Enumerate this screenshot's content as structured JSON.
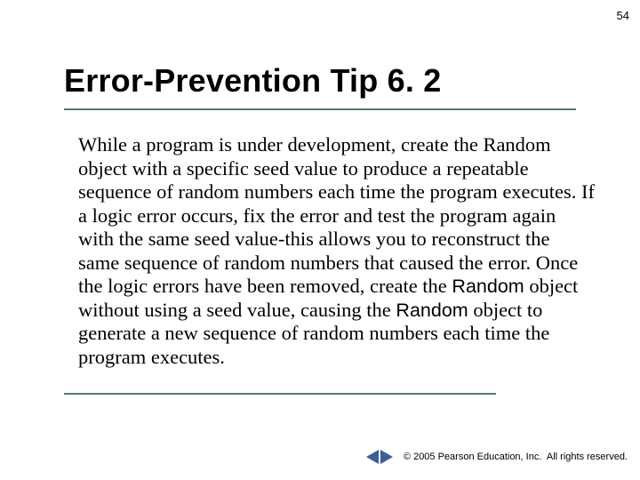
{
  "page_number": "54",
  "title": "Error-Prevention Tip 6. 2",
  "body": {
    "part1": "While a program is under development, create the Random object with a specific seed value to produce a repeatable sequence of random numbers each time the program executes. If a logic error occurs, fix the error and test the program again with the same seed value-this allows you to reconstruct the same sequence of random numbers that caused the error. Once the logic errors have been removed, create the ",
    "code1": "Random",
    "part2": " object without using a seed value, causing the ",
    "code2": "Random",
    "part3": " object to generate a new sequence of random numbers each time the program executes."
  },
  "footer": {
    "copyright_symbol": "©",
    "text": " 2005 Pearson Education, Inc.  All rights reserved."
  }
}
